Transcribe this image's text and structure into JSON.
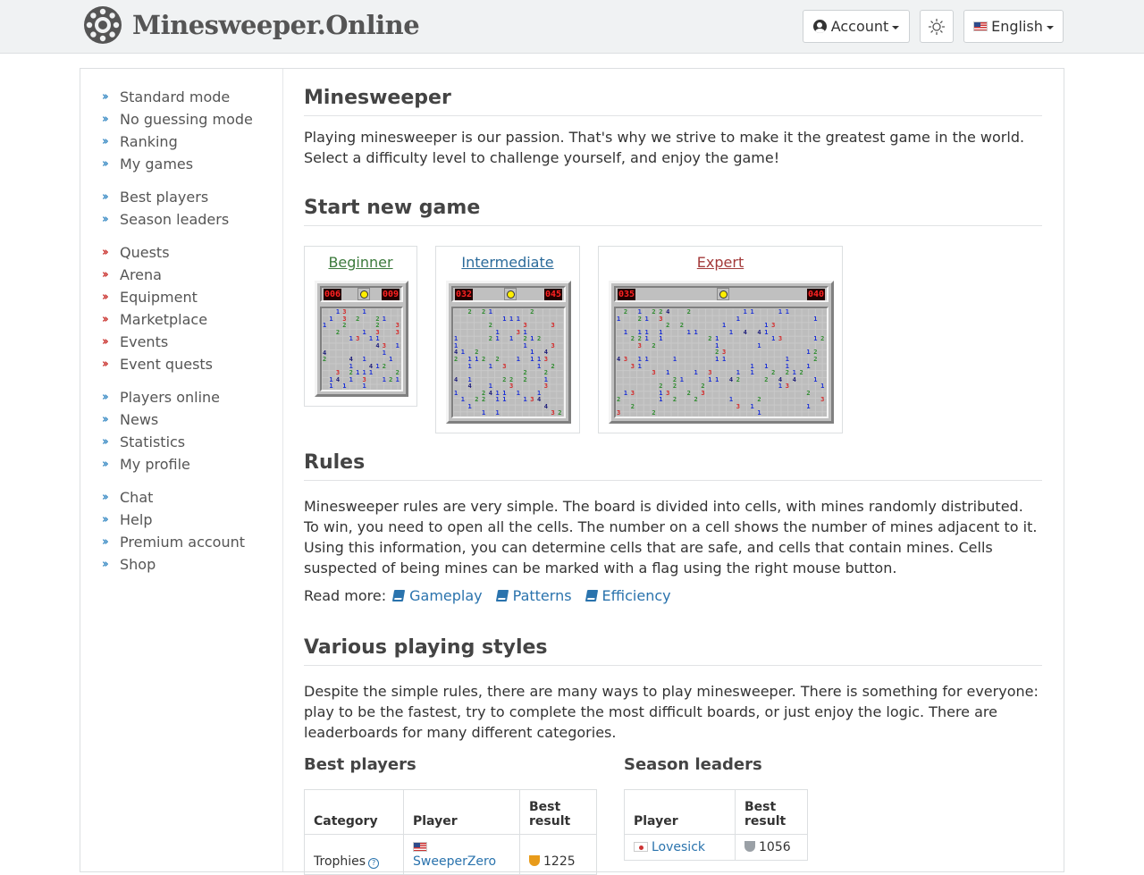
{
  "brand": {
    "name": "Minesweeper.Online",
    "logo_icon": "mine-logo-icon"
  },
  "header": {
    "account_label": "Account",
    "language_label": "English",
    "theme_icon": "sun-icon"
  },
  "sidebar": {
    "groups": [
      {
        "items": [
          {
            "label": "Standard mode",
            "color": "#3a8bc4"
          },
          {
            "label": "No guessing mode",
            "color": "#3a8bc4"
          },
          {
            "label": "Ranking",
            "color": "#3a8bc4"
          },
          {
            "label": "My games",
            "color": "#3a8bc4"
          }
        ]
      },
      {
        "items": [
          {
            "label": "Best players",
            "color": "#3a8bc4"
          },
          {
            "label": "Season leaders",
            "color": "#3a8bc4"
          }
        ]
      },
      {
        "items": [
          {
            "label": "Quests",
            "color": "#c9302c"
          },
          {
            "label": "Arena",
            "color": "#c9302c"
          },
          {
            "label": "Equipment",
            "color": "#c9302c"
          },
          {
            "label": "Marketplace",
            "color": "#c9302c"
          },
          {
            "label": "Events",
            "color": "#c9302c"
          },
          {
            "label": "Event quests",
            "color": "#c9302c"
          }
        ]
      },
      {
        "items": [
          {
            "label": "Players online",
            "color": "#3a8bc4"
          },
          {
            "label": "News",
            "color": "#3a8bc4"
          },
          {
            "label": "Statistics",
            "color": "#3a8bc4"
          },
          {
            "label": "My profile",
            "color": "#3a8bc4"
          }
        ]
      },
      {
        "items": [
          {
            "label": "Chat",
            "color": "#3a8bc4"
          },
          {
            "label": "Help",
            "color": "#3a8bc4"
          },
          {
            "label": "Premium account",
            "color": "#3a8bc4"
          },
          {
            "label": "Shop",
            "color": "#3a8bc4"
          }
        ]
      }
    ]
  },
  "main": {
    "title": "Minesweeper",
    "intro": "Playing minesweeper is our passion. That's why we strive to make it the greatest game in the world. Select a difficulty level to challenge yourself, and enjoy the game!",
    "start_title": "Start new game",
    "games": [
      {
        "label": "Beginner",
        "color": "#3c7a3c",
        "mines": "006",
        "time": "009"
      },
      {
        "label": "Intermediate",
        "color": "#2a6a9a",
        "mines": "032",
        "time": "045"
      },
      {
        "label": "Expert",
        "color": "#a33a3a",
        "mines": "035",
        "time": "040"
      }
    ],
    "rules_title": "Rules",
    "rules_text": "Minesweeper rules are very simple. The board is divided into cells, with mines randomly distributed. To win, you need to open all the cells. The number on a cell shows the number of mines adjacent to it. Using this information, you can determine cells that are safe, and cells that contain mines. Cells suspected of being mines can be marked with a flag using the right mouse button.",
    "read_more_label": "Read more:",
    "read_more_links": [
      "Gameplay",
      "Patterns",
      "Efficiency"
    ],
    "styles_title": "Various playing styles",
    "styles_text": "Despite the simple rules, there are many ways to play minesweeper. There is something for everyone: play to be the fastest, try to complete the most difficult boards, or just enjoy the logic. There are leaderboards for many different categories."
  },
  "best_players": {
    "title": "Best players",
    "headers": [
      "Category",
      "Player",
      "Best\nresult"
    ],
    "rows": [
      {
        "category": "Trophies",
        "player": "SweeperZero",
        "result": "1225"
      }
    ]
  },
  "season_leaders": {
    "title": "Season leaders",
    "headers": [
      "Player",
      "Best\nresult"
    ],
    "rows": [
      {
        "player": "Lovesick",
        "result": "1056"
      }
    ]
  }
}
